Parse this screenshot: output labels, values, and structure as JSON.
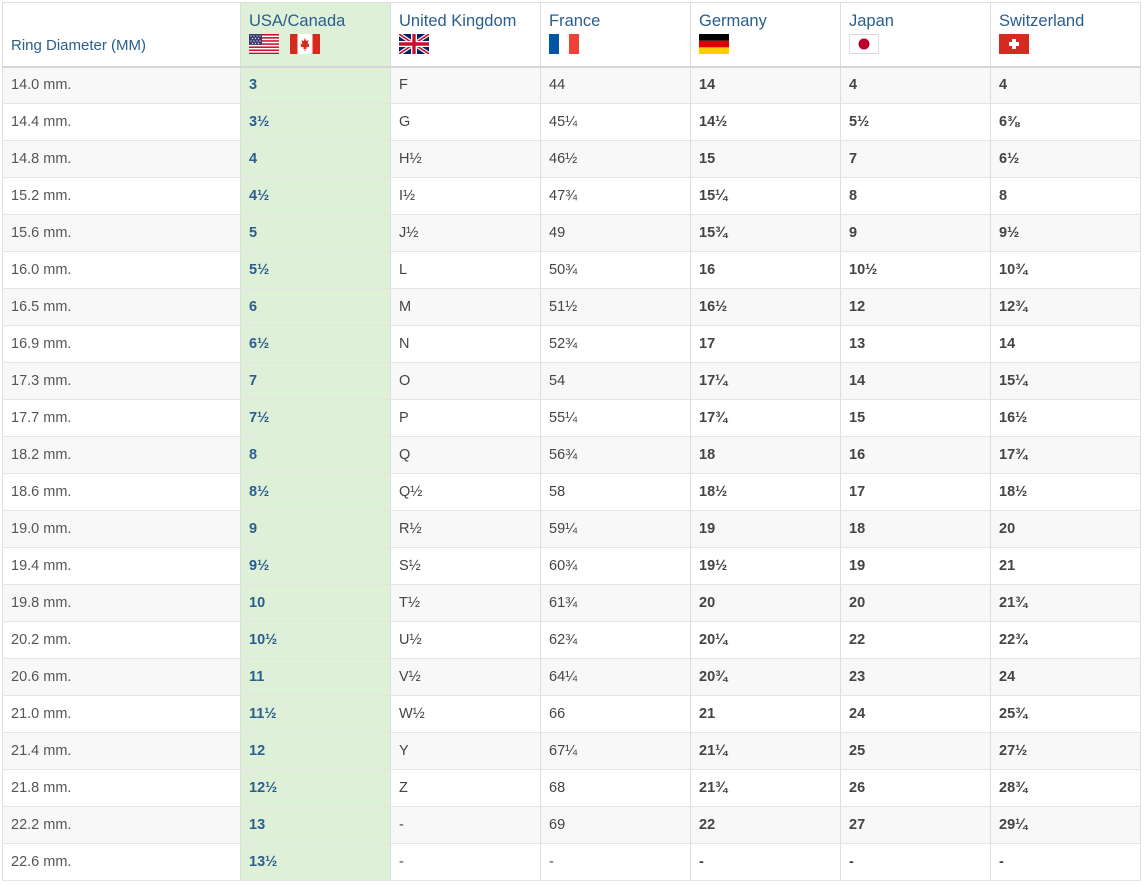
{
  "headers": {
    "diameter": "Ring Diameter (MM)",
    "usa": "USA/Canada",
    "uk": "United Kingdom",
    "france": "France",
    "germany": "Germany",
    "japan": "Japan",
    "switzerland": "Switzerland"
  },
  "flags": {
    "usa": "us-flag-icon",
    "canada": "canada-flag-icon",
    "uk": "uk-flag-icon",
    "france": "france-flag-icon",
    "germany": "germany-flag-icon",
    "japan": "japan-flag-icon",
    "switzerland": "switzerland-flag-icon"
  },
  "colors": {
    "header_text": "#2a5e8c",
    "highlight_column": "#dff0d8",
    "stripe": "#f8f8f8"
  },
  "rows": [
    [
      "14.0 mm.",
      "3",
      "F",
      "44",
      "14",
      "4",
      "4"
    ],
    [
      "14.4 mm.",
      "3½",
      "G",
      "45¼",
      "14½",
      "5½",
      "6⅜"
    ],
    [
      "14.8 mm.",
      "4",
      "H½",
      "46½",
      "15",
      "7",
      "6½"
    ],
    [
      "15.2 mm.",
      "4½",
      "I½",
      "47¾",
      "15¼",
      "8",
      "8"
    ],
    [
      "15.6 mm.",
      "5",
      "J½",
      "49",
      "15¾",
      "9",
      "9½"
    ],
    [
      "16.0 mm.",
      "5½",
      "L",
      "50¾",
      "16",
      "10½",
      "10¾"
    ],
    [
      "16.5 mm.",
      "6",
      "M",
      "51½",
      "16½",
      "12",
      "12¾"
    ],
    [
      "16.9 mm.",
      "6½",
      "N",
      "52¾",
      "17",
      "13",
      "14"
    ],
    [
      "17.3 mm.",
      "7",
      "O",
      "54",
      "17¼",
      "14",
      "15¼"
    ],
    [
      "17.7 mm.",
      "7½",
      "P",
      "55¼",
      "17¾",
      "15",
      "16½"
    ],
    [
      "18.2 mm.",
      "8",
      "Q",
      "56¾",
      "18",
      "16",
      "17¾"
    ],
    [
      "18.6 mm.",
      "8½",
      "Q½",
      "58",
      "18½",
      "17",
      "18½"
    ],
    [
      "19.0 mm.",
      "9",
      "R½",
      "59¼",
      "19",
      "18",
      "20"
    ],
    [
      "19.4 mm.",
      "9½",
      "S½",
      "60¾",
      "19½",
      "19",
      "21"
    ],
    [
      "19.8 mm.",
      "10",
      "T½",
      "61¾",
      "20",
      "20",
      "21¾"
    ],
    [
      "20.2 mm.",
      "10½",
      "U½",
      "62¾",
      "20¼",
      "22",
      "22¾"
    ],
    [
      "20.6 mm.",
      "11",
      "V½",
      "64¼",
      "20¾",
      "23",
      "24"
    ],
    [
      "21.0 mm.",
      "11½",
      "W½",
      "66",
      "21",
      "24",
      "25¾"
    ],
    [
      "21.4 mm.",
      "12",
      "Y",
      "67¼",
      "21¼",
      "25",
      "27½"
    ],
    [
      "21.8 mm.",
      "12½",
      "Z",
      "68",
      "21¾",
      "26",
      "28¾"
    ],
    [
      "22.2 mm.",
      "13",
      "-",
      "69",
      "22",
      "27",
      "29¼"
    ],
    [
      "22.6 mm.",
      "13½",
      "-",
      "-",
      "-",
      "-",
      "-"
    ]
  ]
}
